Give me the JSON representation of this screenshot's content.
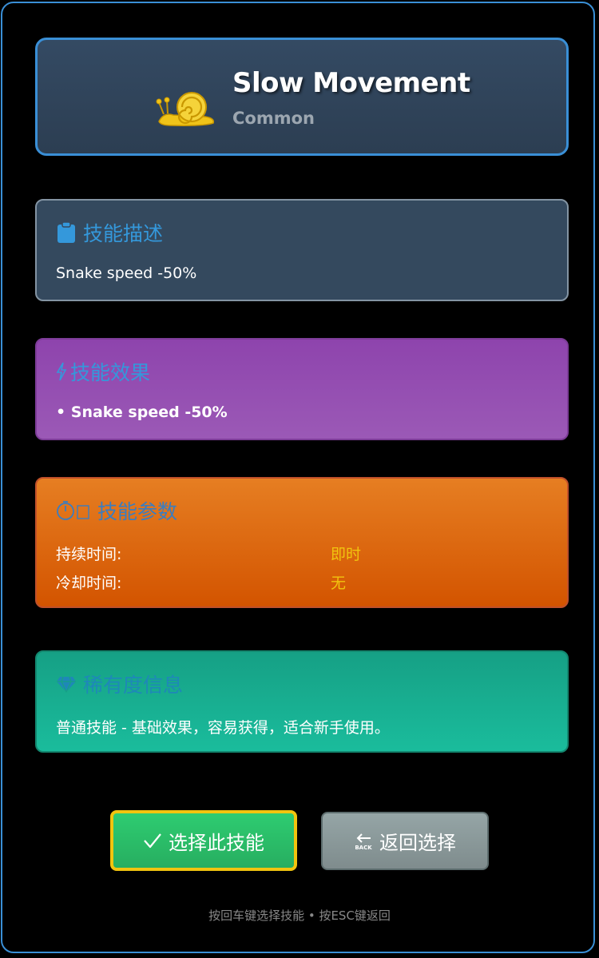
{
  "header": {
    "icon": "snail-icon",
    "name": "Slow Movement",
    "rarity": "Common"
  },
  "description": {
    "icon": "clipboard-icon",
    "title": "技能描述",
    "text": "Snake speed -50%"
  },
  "effects": {
    "icon": "lightning-icon",
    "title": "技能效果",
    "items": [
      "• Snake speed -50%"
    ]
  },
  "params": {
    "icon": "stopwatch-icon",
    "title": "技能参数",
    "rows": [
      {
        "label": "持续时间:",
        "value": "即时"
      },
      {
        "label": "冷却时间:",
        "value": "无"
      }
    ]
  },
  "rarity_info": {
    "icon": "gem-icon",
    "title": "稀有度信息",
    "text": "普通技能 - 基础效果，容易获得，适合新手使用。"
  },
  "buttons": {
    "select_label": "选择此技能",
    "back_label": "返回选择",
    "back_icon_text": "BACK"
  },
  "footer": {
    "hint": "按回车键选择技能 • 按ESC键返回"
  },
  "colors": {
    "accent_blue": "#3a8fd6",
    "value_yellow": "#f1c40f",
    "title_blue": "#3498db"
  }
}
